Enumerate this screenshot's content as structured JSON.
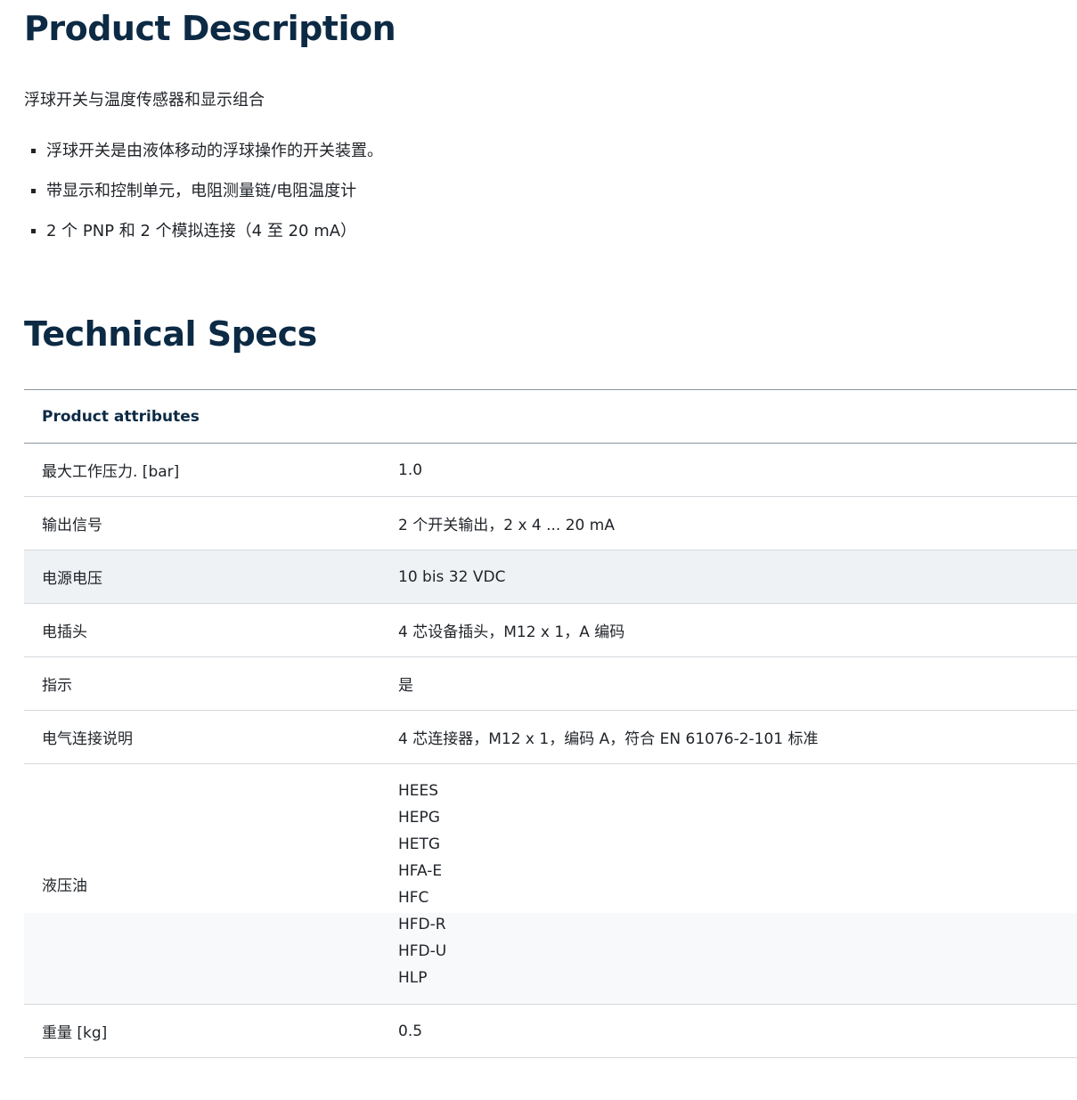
{
  "product_description": {
    "title": "Product Description",
    "intro": "浮球开关与温度传感器和显示组合",
    "bullets": [
      "浮球开关是由液体移动的浮球操作的开关装置。",
      "带显示和控制单元，电阻测量链/电阻温度计",
      "2 个 PNP 和 2 个模拟连接（4 至 20 mA）"
    ]
  },
  "technical_specs": {
    "title": "Technical Specs",
    "table_header": "Product attributes",
    "rows": [
      {
        "attribute": "最大工作压力. [bar]",
        "value": "1.0"
      },
      {
        "attribute": "输出信号",
        "value": "2 个开关输出，2 x 4 ... 20 mA"
      },
      {
        "attribute": "电源电压",
        "value": "10 bis 32 VDC"
      },
      {
        "attribute": "电插头",
        "value": "4 芯设备插头，M12 x 1，A 编码"
      },
      {
        "attribute": "指示",
        "value": "是"
      },
      {
        "attribute": "电气连接说明",
        "value": "4 芯连接器，M12 x 1，编码 A，符合 EN 61076-2-101 标准"
      },
      {
        "attribute": "液压油",
        "values": [
          "HEES",
          "HEPG",
          "HETG",
          "HFA-E",
          "HFC",
          "HFD-R",
          "HFD-U",
          "HLP"
        ]
      },
      {
        "attribute": "重量 [kg]",
        "value": "0.5"
      }
    ]
  }
}
